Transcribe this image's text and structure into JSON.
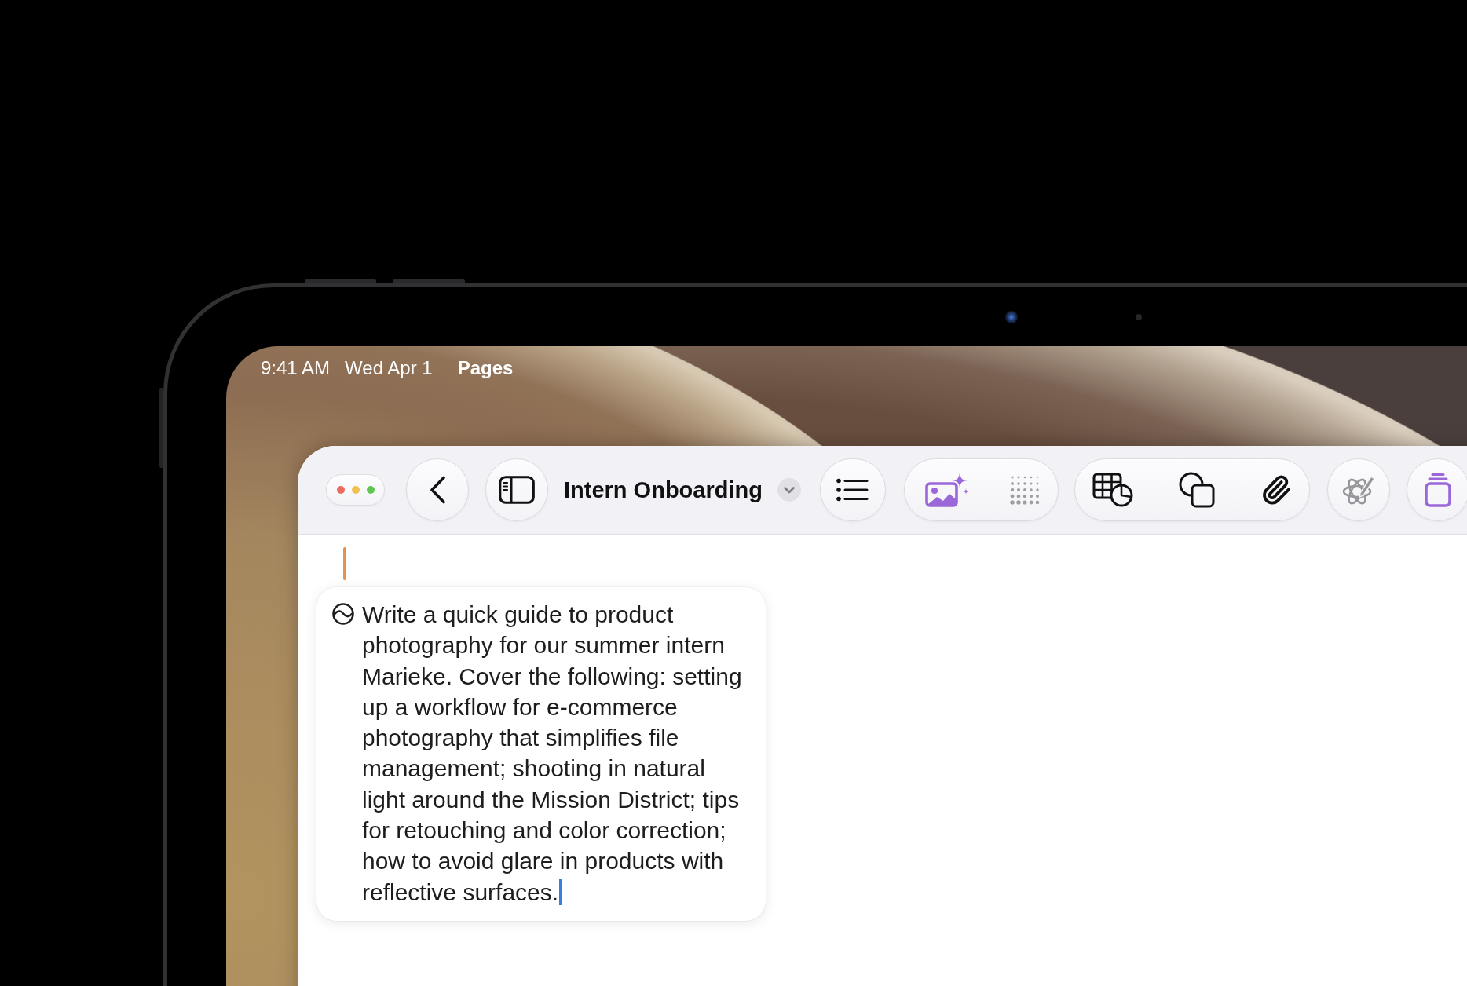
{
  "status_bar": {
    "time": "9:41 AM",
    "date": "Wed Apr 1",
    "app": "Pages"
  },
  "toolbar": {
    "title": "Intern Onboarding"
  },
  "document": {
    "prompt": "Write a quick guide to product photography for our summer intern Marieke. Cover the following: setting up a workflow for e-commerce photography that simplifies file management; shooting in natural light around the Mission District; tips for retouching and color correction; how to avoid glare in products with reflective surfaces."
  }
}
